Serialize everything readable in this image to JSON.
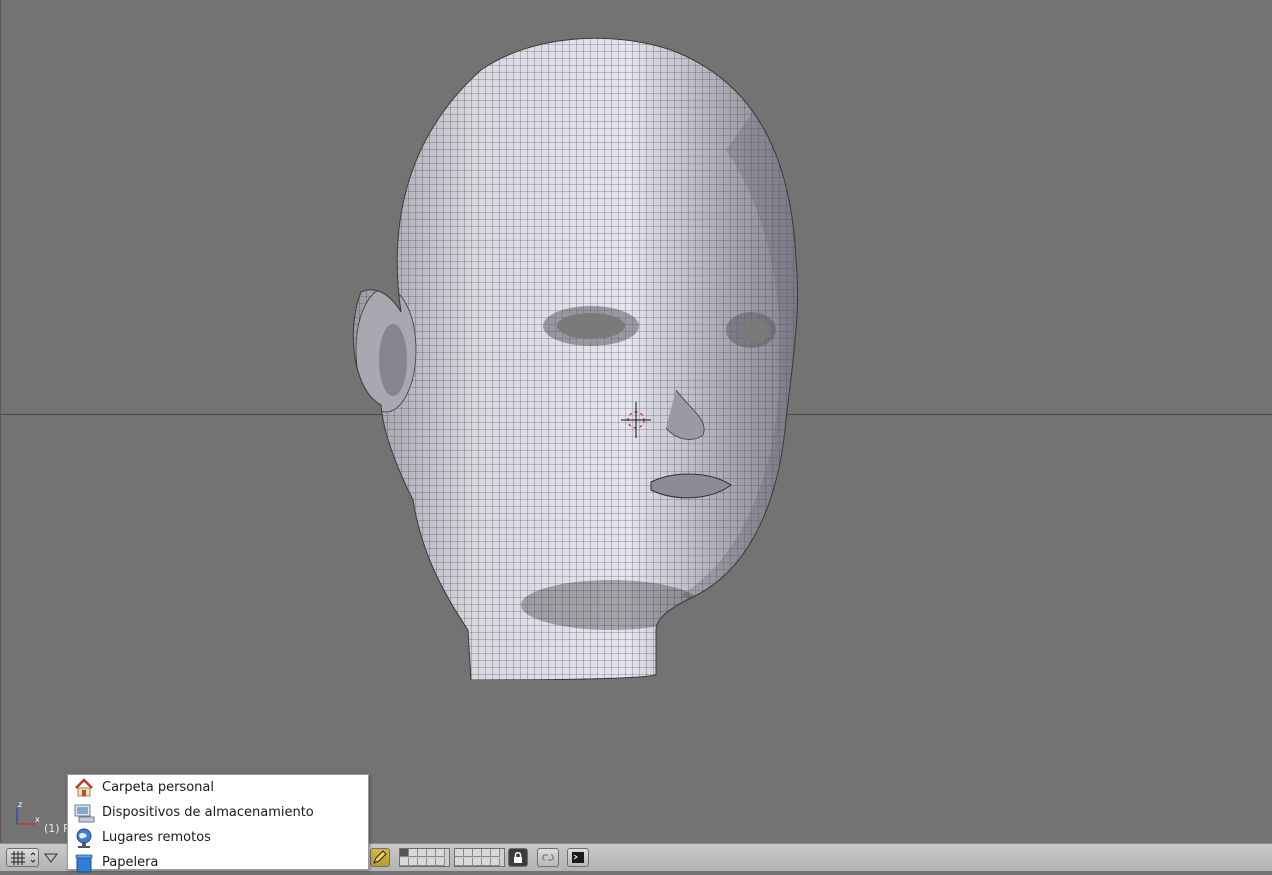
{
  "viewport": {
    "object_info": "(1) P",
    "background_color": "#737373",
    "model": "head-mesh-wireframe",
    "axis_labels": {
      "z": "z",
      "x": "x"
    }
  },
  "places_menu": {
    "items": [
      {
        "label": "Carpeta personal",
        "icon": "home-folder-icon"
      },
      {
        "label": "Dispositivos de almacenamiento",
        "icon": "storage-devices-icon"
      },
      {
        "label": "Lugares remotos",
        "icon": "network-places-icon"
      },
      {
        "label": "Papelera",
        "icon": "trash-icon"
      }
    ]
  },
  "header": {
    "editor_type_icon": "grid-icon",
    "menu_toggle_icon": "triangle-down-icon",
    "snap_icon": "pencil-icon",
    "lock_icon": "lock-icon",
    "link_icon": "link-icon",
    "render_icon": "render-icon"
  }
}
